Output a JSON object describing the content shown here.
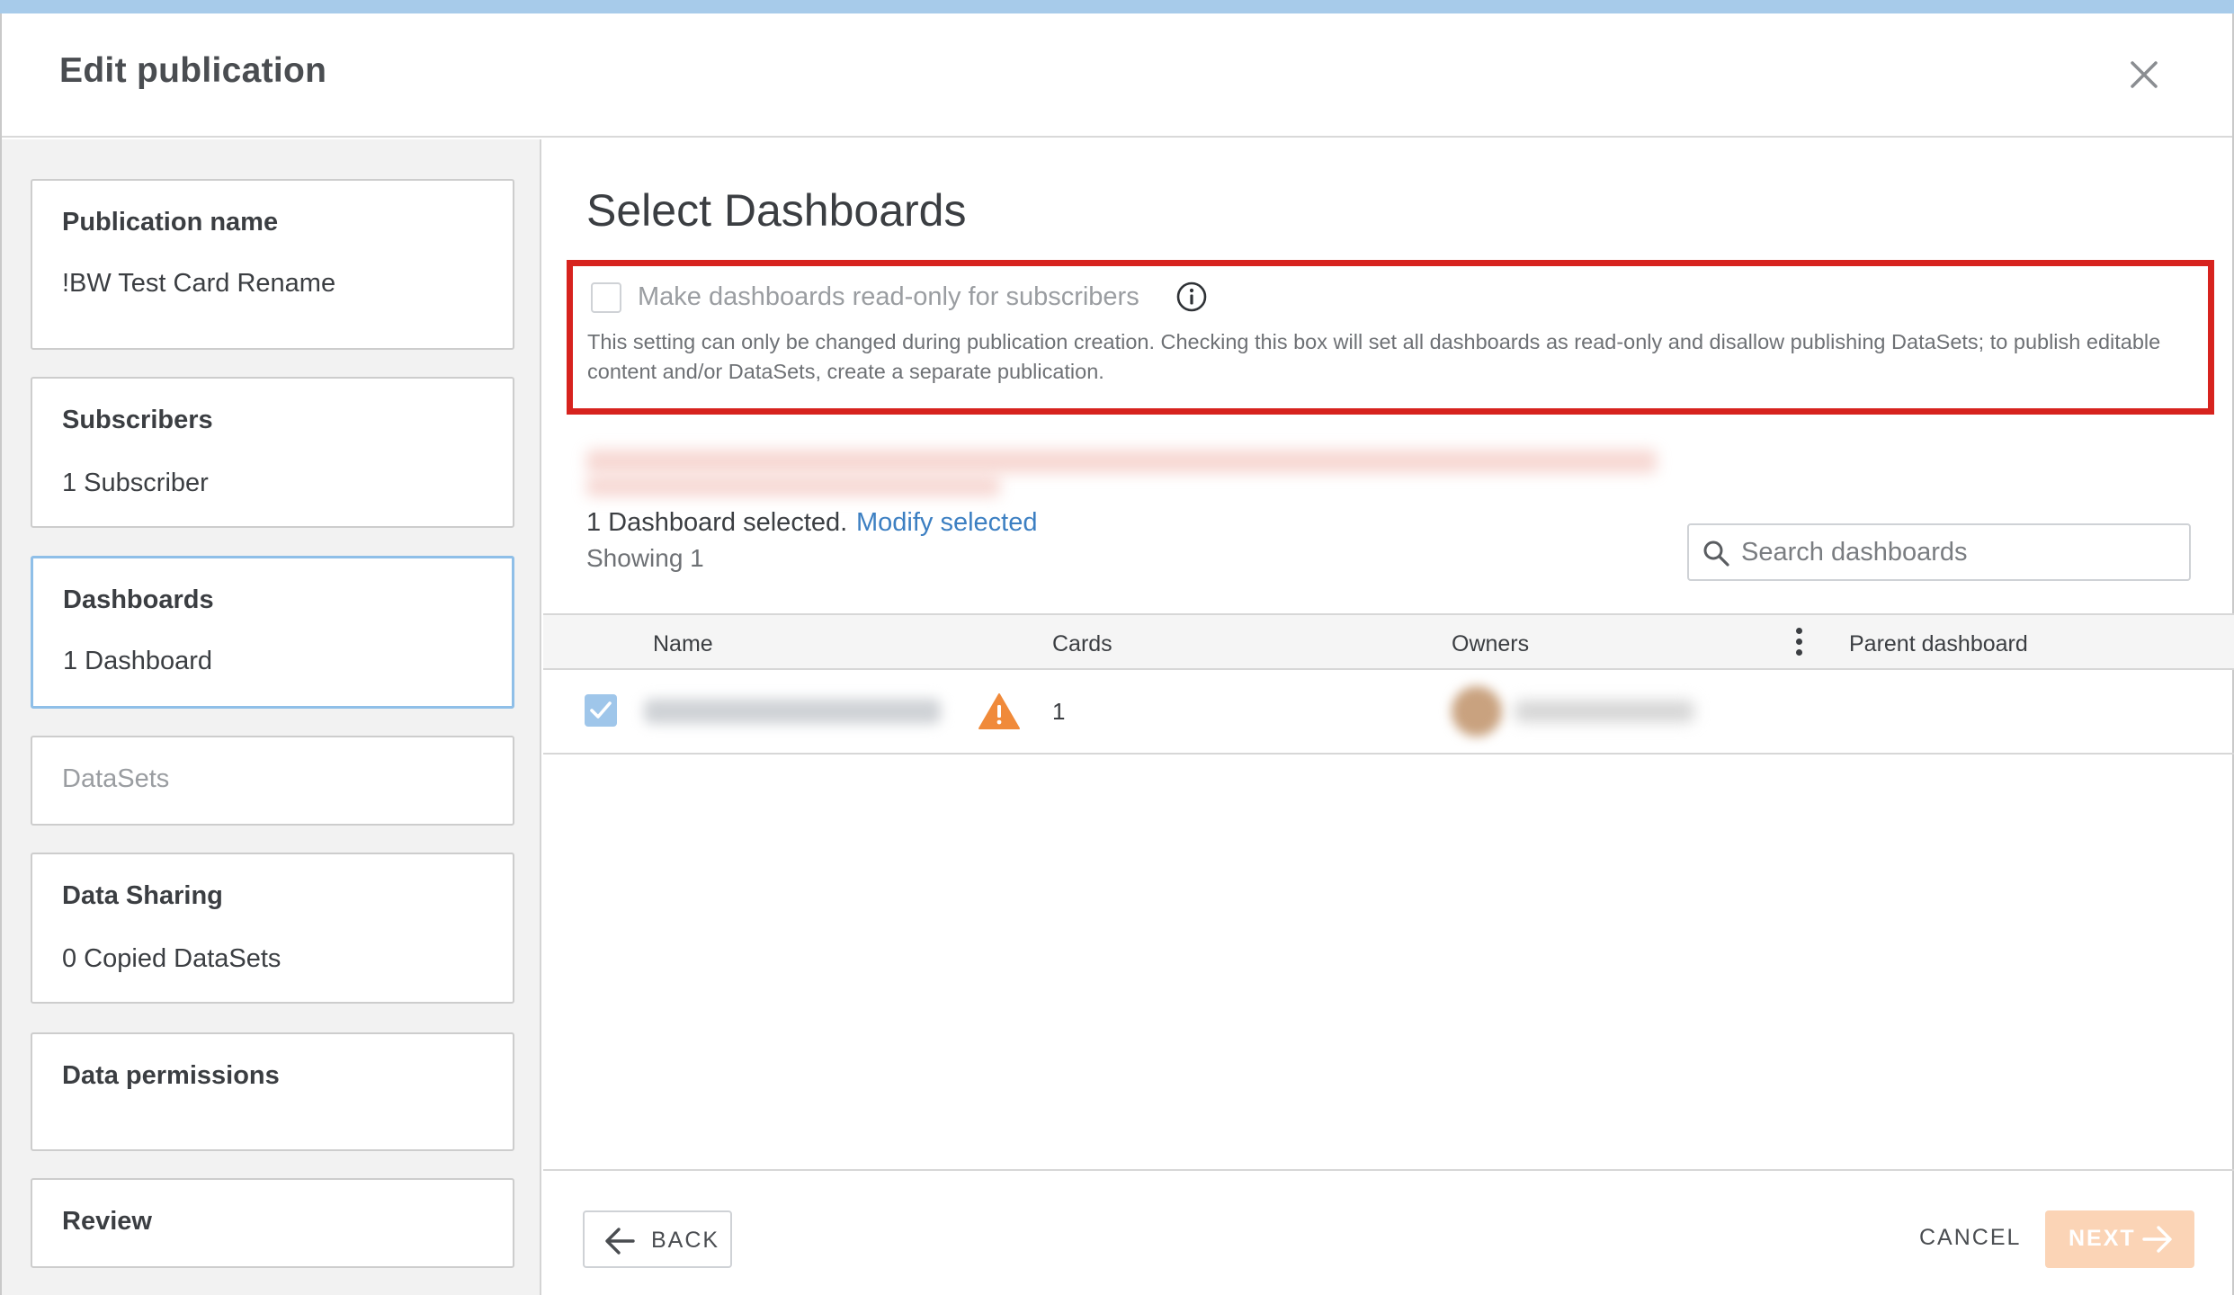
{
  "modal": {
    "title": "Edit publication"
  },
  "sidebar": {
    "steps": [
      {
        "title": "Publication name",
        "value": "!BW Test Card Rename"
      },
      {
        "title": "Subscribers",
        "value": "1 Subscriber"
      },
      {
        "title": "Dashboards",
        "value": "1 Dashboard"
      },
      {
        "title": "DataSets",
        "value": ""
      },
      {
        "title": "Data Sharing",
        "value": "0 Copied DataSets"
      },
      {
        "title": "Data permissions",
        "value": ""
      },
      {
        "title": "Review",
        "value": ""
      }
    ]
  },
  "main": {
    "section_title": "Select Dashboards",
    "readonly": {
      "label": "Make dashboards read-only for subscribers",
      "description": "This setting can only be changed during publication creation. Checking this box will set all dashboards as read-only and disallow publishing DataSets; to publish editable content and/or DataSets, create a separate publication."
    },
    "selection": {
      "count_text": "1 Dashboard selected.",
      "modify_link": "Modify selected",
      "showing": "Showing 1"
    },
    "search": {
      "placeholder": "Search dashboards"
    },
    "table": {
      "columns": [
        "Name",
        "Cards",
        "Owners",
        "Parent dashboard"
      ],
      "rows": [
        {
          "cards": "1"
        }
      ]
    }
  },
  "footer": {
    "back_label": "BACK",
    "cancel_label": "CANCEL",
    "next_label": "NEXT"
  },
  "colors": {
    "highlight_border": "#d7231e",
    "link": "#3c7fc2",
    "next_disabled": "#fbd4b6",
    "checkbox_checked": "#9fc6ea",
    "warning": "#f08a3a"
  }
}
